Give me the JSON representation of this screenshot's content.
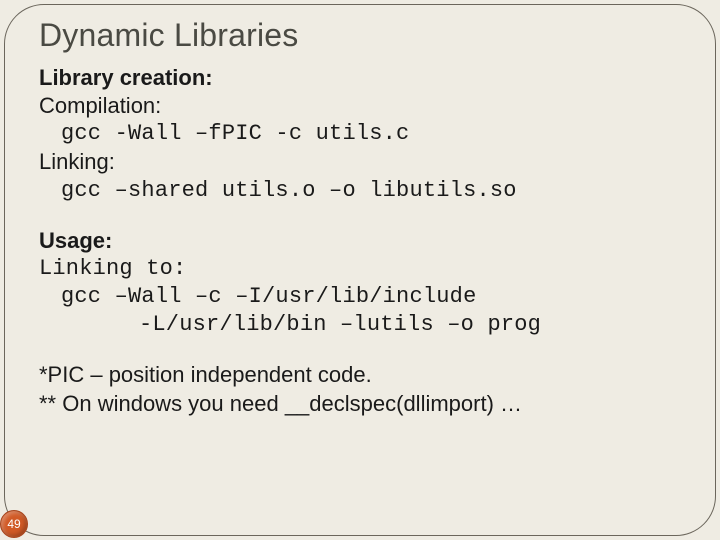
{
  "title": "Dynamic Libraries",
  "sectionA": {
    "heading": "Library creation:",
    "compLabel": "Compilation:",
    "compCmd": "gcc -Wall –fPIC -c utils.c",
    "linkLabel": "Linking:",
    "linkCmd": "gcc –shared utils.o –o libutils.so"
  },
  "sectionB": {
    "heading": "Usage:",
    "linkingLabel": "Linking to:",
    "cmd1": "gcc –Wall –c –I/usr/lib/include",
    "cmd2": "-L/usr/lib/bin –lutils –o prog"
  },
  "notes": {
    "n1": "*PIC – position independent code.",
    "n2": "** On windows you need __declspec(dllimport) …"
  },
  "pageNumber": "49"
}
